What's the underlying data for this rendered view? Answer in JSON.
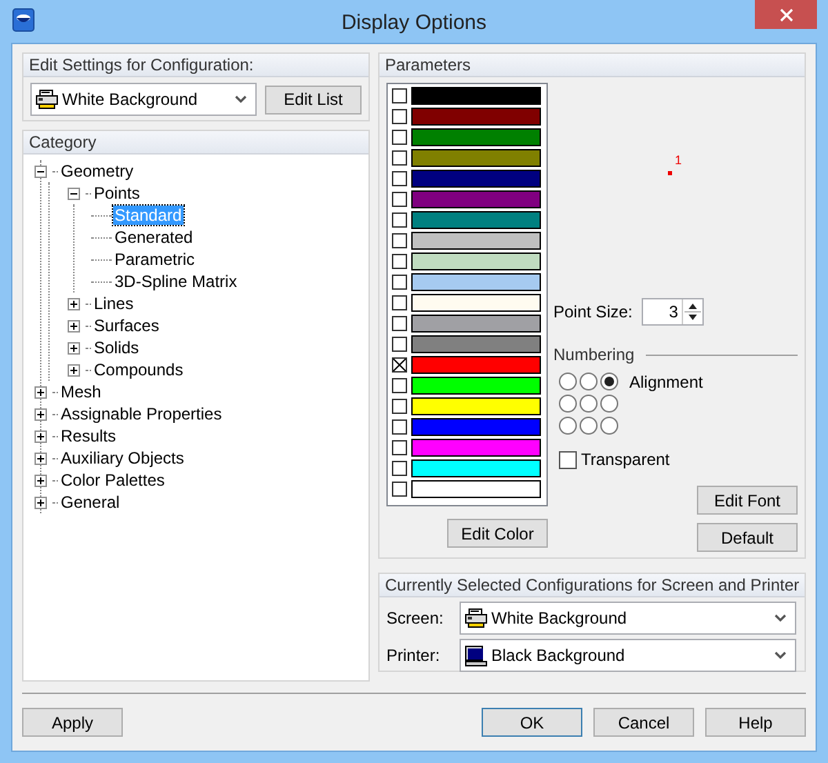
{
  "window": {
    "title": "Display Options"
  },
  "edit_settings": {
    "title": "Edit Settings for Configuration:",
    "configuration": "White Background",
    "edit_list_button": {
      "label": "Edit List"
    }
  },
  "category": {
    "title": "Category",
    "tree": [
      {
        "label": "Geometry",
        "expanded": true,
        "selected": false,
        "children": [
          {
            "label": "Points",
            "expanded": true,
            "selected": false,
            "children": [
              {
                "label": "Standard",
                "selected": true
              },
              {
                "label": "Generated",
                "selected": false
              },
              {
                "label": "Parametric",
                "selected": false
              },
              {
                "label": "3D-Spline Matrix",
                "selected": false
              }
            ]
          },
          {
            "label": "Lines",
            "expanded": false,
            "selected": false
          },
          {
            "label": "Surfaces",
            "expanded": false,
            "selected": false
          },
          {
            "label": "Solids",
            "expanded": false,
            "selected": false
          },
          {
            "label": "Compounds",
            "expanded": false,
            "selected": false
          }
        ]
      },
      {
        "label": "Mesh",
        "expanded": false,
        "selected": false
      },
      {
        "label": "Assignable Properties",
        "expanded": false,
        "selected": false
      },
      {
        "label": "Results",
        "expanded": false,
        "selected": false
      },
      {
        "label": "Auxiliary Objects",
        "expanded": false,
        "selected": false
      },
      {
        "label": "Color Palettes",
        "expanded": false,
        "selected": false
      },
      {
        "label": "General",
        "expanded": false,
        "selected": false
      }
    ]
  },
  "parameters": {
    "title": "Parameters",
    "colors": [
      {
        "color": "#000000",
        "checked": false
      },
      {
        "color": "#800000",
        "checked": false
      },
      {
        "color": "#008000",
        "checked": false
      },
      {
        "color": "#808000",
        "checked": false
      },
      {
        "color": "#000080",
        "checked": false
      },
      {
        "color": "#800080",
        "checked": false
      },
      {
        "color": "#008080",
        "checked": false
      },
      {
        "color": "#c0c0c0",
        "checked": false
      },
      {
        "color": "#c0dcc0",
        "checked": false
      },
      {
        "color": "#a6caf0",
        "checked": false
      },
      {
        "color": "#fffbf0",
        "checked": false
      },
      {
        "color": "#a0a0a4",
        "checked": false
      },
      {
        "color": "#808080",
        "checked": false
      },
      {
        "color": "#ff0000",
        "checked": true
      },
      {
        "color": "#00ff00",
        "checked": false
      },
      {
        "color": "#ffff00",
        "checked": false
      },
      {
        "color": "#0000ff",
        "checked": false
      },
      {
        "color": "#ff00ff",
        "checked": false
      },
      {
        "color": "#00ffff",
        "checked": false
      },
      {
        "color": "#ffffff",
        "checked": false
      }
    ],
    "edit_color_button": {
      "label": "Edit Color"
    },
    "preview": {
      "point_label": "1"
    },
    "point_size": {
      "label": "Point Size:",
      "value": "3"
    },
    "numbering": {
      "title": "Numbering",
      "alignment_label": "Alignment",
      "alignment": [
        {
          "selected": false
        },
        {
          "selected": false
        },
        {
          "selected": true
        },
        {
          "selected": false
        },
        {
          "selected": false
        },
        {
          "selected": false
        },
        {
          "selected": false
        },
        {
          "selected": false
        },
        {
          "selected": false
        }
      ]
    },
    "transparent": {
      "label": "Transparent",
      "checked": false
    },
    "edit_font_button": {
      "label": "Edit Font"
    },
    "default_button": {
      "label": "Default"
    }
  },
  "current_configurations": {
    "title": "Currently Selected Configurations for Screen and Printer",
    "screen": {
      "label": "Screen:",
      "value": "White Background"
    },
    "printer": {
      "label": "Printer:",
      "value": "Black Background"
    }
  },
  "buttons": [
    {
      "label": "Apply",
      "default": false
    },
    {
      "label": "OK",
      "default": true
    },
    {
      "label": "Cancel",
      "default": false
    },
    {
      "label": "Help",
      "default": false
    }
  ]
}
